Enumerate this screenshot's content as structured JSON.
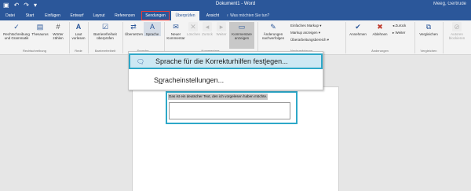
{
  "window": {
    "title": "Dokument1 - Word",
    "user": "Meeg, Gertrude",
    "qat": [
      "save-icon",
      "undo-icon",
      "redo-icon",
      "customize-icon"
    ]
  },
  "tabs": [
    {
      "label": "Datei"
    },
    {
      "label": "Start"
    },
    {
      "label": "Einfügen"
    },
    {
      "label": "Entwurf"
    },
    {
      "label": "Layout"
    },
    {
      "label": "Referenzen"
    },
    {
      "label": "Sendungen"
    },
    {
      "label": "Überprüfen"
    },
    {
      "label": "Ansicht"
    }
  ],
  "tellme": "♀ Was möchten Sie tun?",
  "ribbon": {
    "proofing": {
      "spelling": "Rechtschreibung und Grammatik",
      "thesaurus": "Thesaurus",
      "wordcount": "Wörter zählen",
      "group": "Rechtschreibung"
    },
    "speech": {
      "read_aloud": "Laut vorlesen",
      "group": "Rede"
    },
    "accessibility": {
      "check": "Barrierefreiheit überprüfen",
      "group": "Barrierefreiheit"
    },
    "language": {
      "translate": "Übersetzen",
      "language": "Sprache",
      "group": "Sprache"
    },
    "comments": {
      "new": "Neuer Kommentar",
      "delete": "Löschen",
      "prev": "Zurück",
      "next": "Weiter",
      "show": "Kommentare anzeigen",
      "group": "Kommentare"
    },
    "tracking": {
      "track": "Änderungen nachverfolgen",
      "markup": "Einfaches Markup",
      "show_markup": "Markup anzeigen",
      "pane": "Überarbeitungsbereich",
      "group": "Nachverfolgung"
    },
    "changes": {
      "accept": "Annehmen",
      "reject": "Ablehnen",
      "prev": "Zurück",
      "next": "Weiter",
      "group": "Änderungen"
    },
    "compare": {
      "compare": "Vergleichen",
      "group": "Vergleichen"
    },
    "protect": {
      "block": "Autoren blockieren"
    }
  },
  "menu": {
    "item1_pre": "Sprache für die Korrekturhilfen fest",
    "item1_acc": "l",
    "item1_post": "egen...",
    "item2_pre": "S",
    "item2_acc": "p",
    "item2_post": "racheinstellungen..."
  },
  "document": {
    "text": "Das ist ein deutscher Text, den ich vorgelesen haben möchte."
  }
}
